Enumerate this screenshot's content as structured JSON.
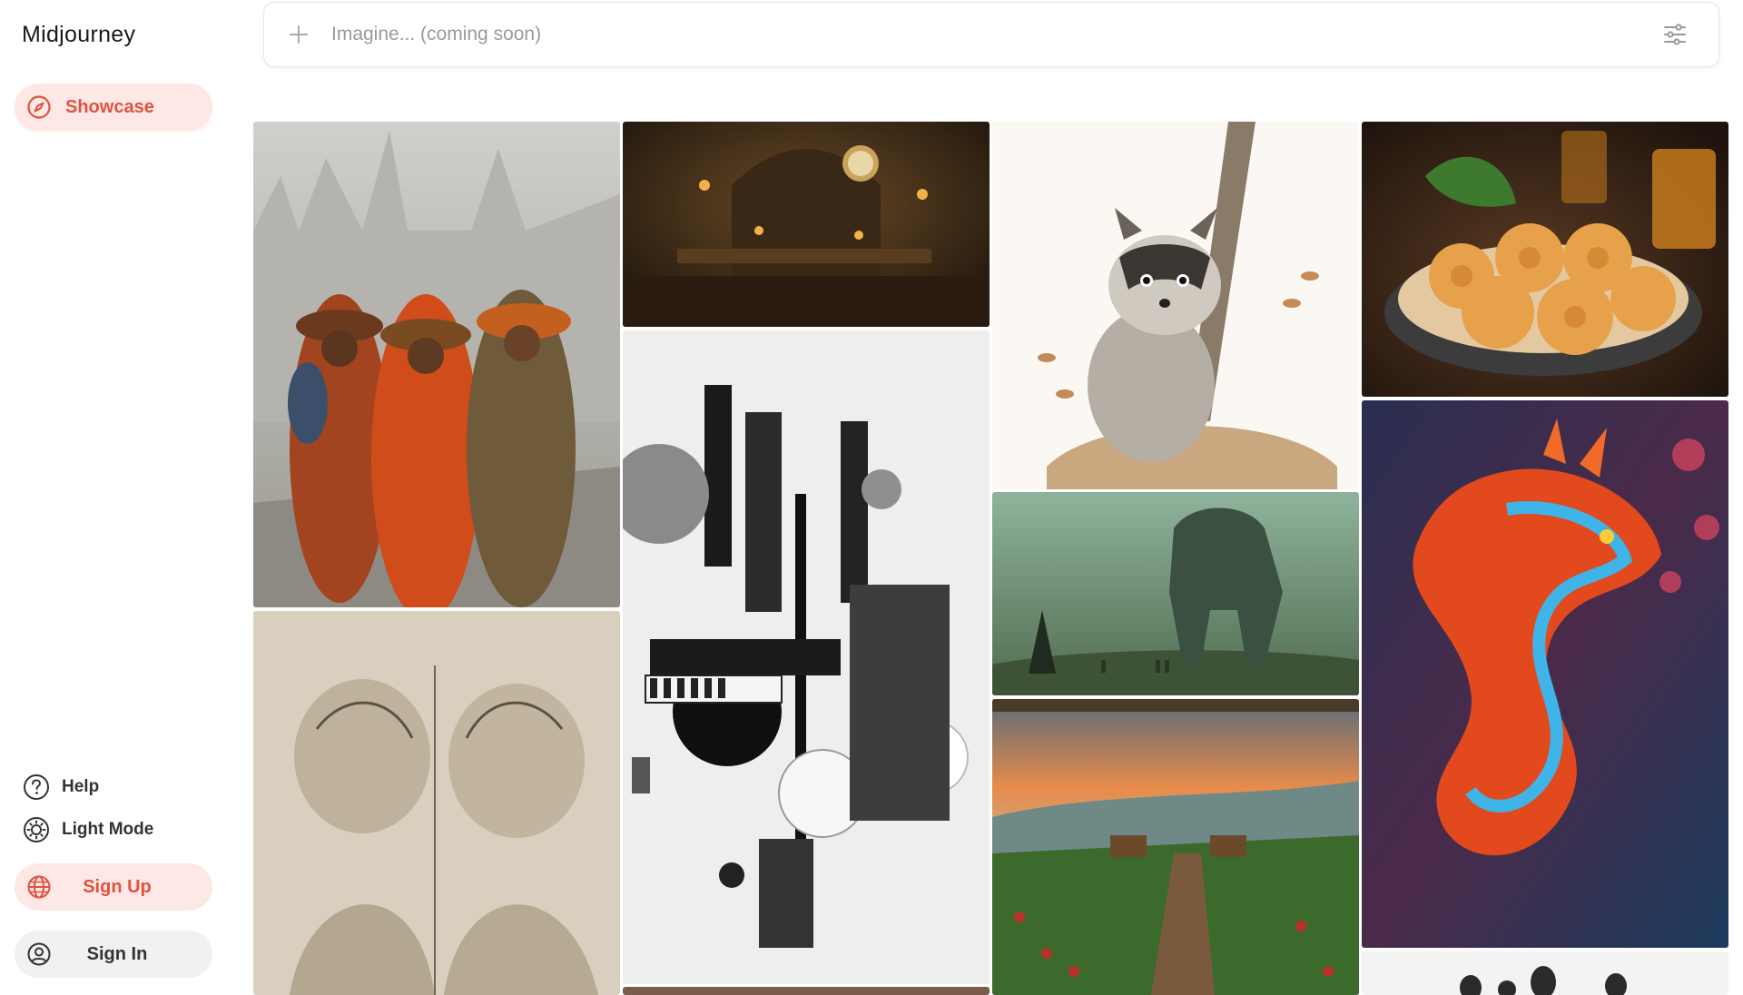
{
  "app": {
    "title": "Midjourney"
  },
  "sidebar": {
    "nav": {
      "showcase_label": "Showcase"
    },
    "help_label": "Help",
    "light_mode_label": "Light Mode",
    "sign_up_label": "Sign Up",
    "sign_in_label": "Sign In"
  },
  "search": {
    "placeholder": "Imagine... (coming soon)"
  },
  "colors": {
    "accent": "#e0523f",
    "accent_bg": "#fde8e5",
    "neutral_bg": "#f1f1f1"
  },
  "gallery": {
    "images": [
      "fashion-women-cathedral",
      "gothic-clock-hall",
      "raccoon-watercolor",
      "cheddar-biscuits",
      "monochrome-abstract-city",
      "green-fog-mech",
      "neon-dragon",
      "sketch-children",
      "coffee-farm-sunset",
      "figures-partial"
    ]
  }
}
